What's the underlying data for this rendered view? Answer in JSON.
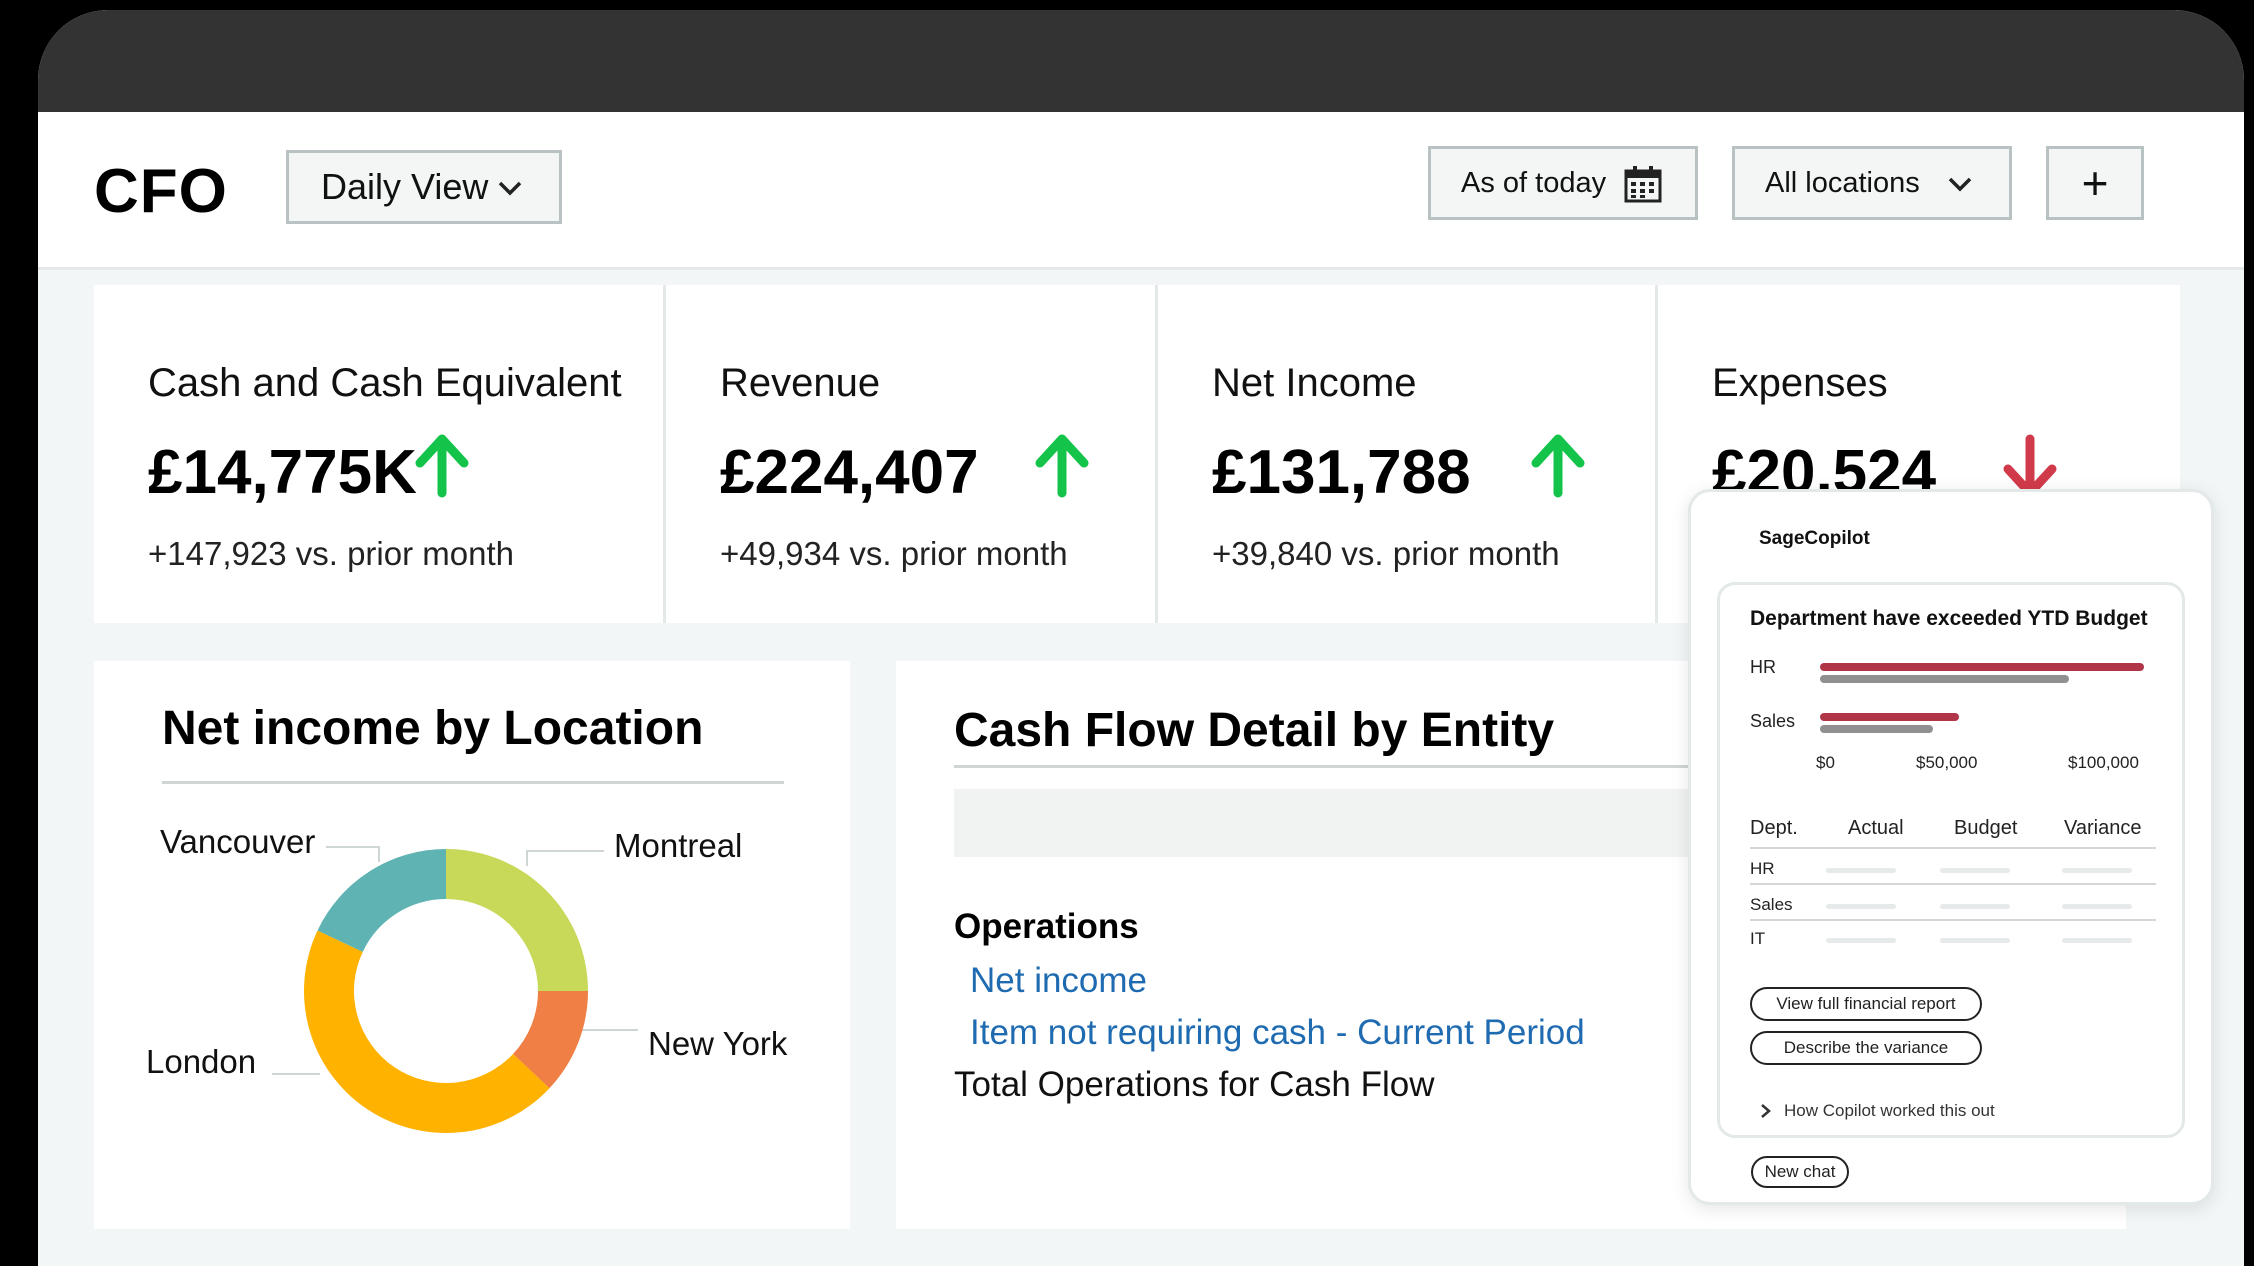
{
  "header": {
    "title": "CFO",
    "view_select": "Daily View",
    "date_select": "As of today",
    "location_select": "All locations",
    "add_label": "+"
  },
  "kpis": [
    {
      "label": "Cash and Cash Equivalent",
      "value": "£14,775K",
      "trend": "up",
      "change": "+147,923 vs. prior month"
    },
    {
      "label": "Revenue",
      "value": "£224,407",
      "trend": "up",
      "change": "+49,934 vs. prior month"
    },
    {
      "label": "Net Income",
      "value": "£131,788",
      "trend": "up",
      "change": "+39,840 vs. prior month"
    },
    {
      "label": "Expenses",
      "value": "£20,524",
      "trend": "down",
      "change": ""
    }
  ],
  "net_income_panel": {
    "title": "Net income by Location",
    "labels": [
      "Vancouver",
      "Montreal",
      "New York",
      "London"
    ]
  },
  "cash_flow_panel": {
    "title": "Cash Flow Detail by Entity",
    "section": "Operations",
    "links": [
      "Net income",
      "Item not requiring cash - Current Period"
    ],
    "total": "Total Operations for Cash Flow"
  },
  "copilot": {
    "name": "SageCopilot",
    "card_title": "Department have exceeded YTD Budget",
    "bar_chart": {
      "categories": [
        "HR",
        "Sales"
      ],
      "axis_ticks": [
        "$0",
        "$50,000",
        "$100,000"
      ]
    },
    "table": {
      "headers": [
        "Dept.",
        "Actual",
        "Budget",
        "Variance"
      ],
      "rows": [
        "HR",
        "Sales",
        "IT"
      ]
    },
    "actions": [
      "View full financial report",
      "Describe the variance"
    ],
    "how_label": "How Copilot worked this out",
    "new_chat": "New chat"
  },
  "colors": {
    "up": "#13c34a",
    "down": "#d13a4a",
    "link": "#1f6bb1",
    "donut": [
      "#c8d95a",
      "#ef7f45",
      "#ffb200",
      "#5fb3b3"
    ],
    "actual_bar": "#b03548",
    "budget_bar": "#909090"
  },
  "donut": {
    "segments": [
      0.25,
      0.12,
      0.45,
      0.18
    ]
  },
  "budget_chart": {
    "axis_max": 100000,
    "series": [
      {
        "values": [
          100000,
          43000
        ]
      },
      {
        "values": [
          77000,
          35000
        ]
      }
    ]
  }
}
